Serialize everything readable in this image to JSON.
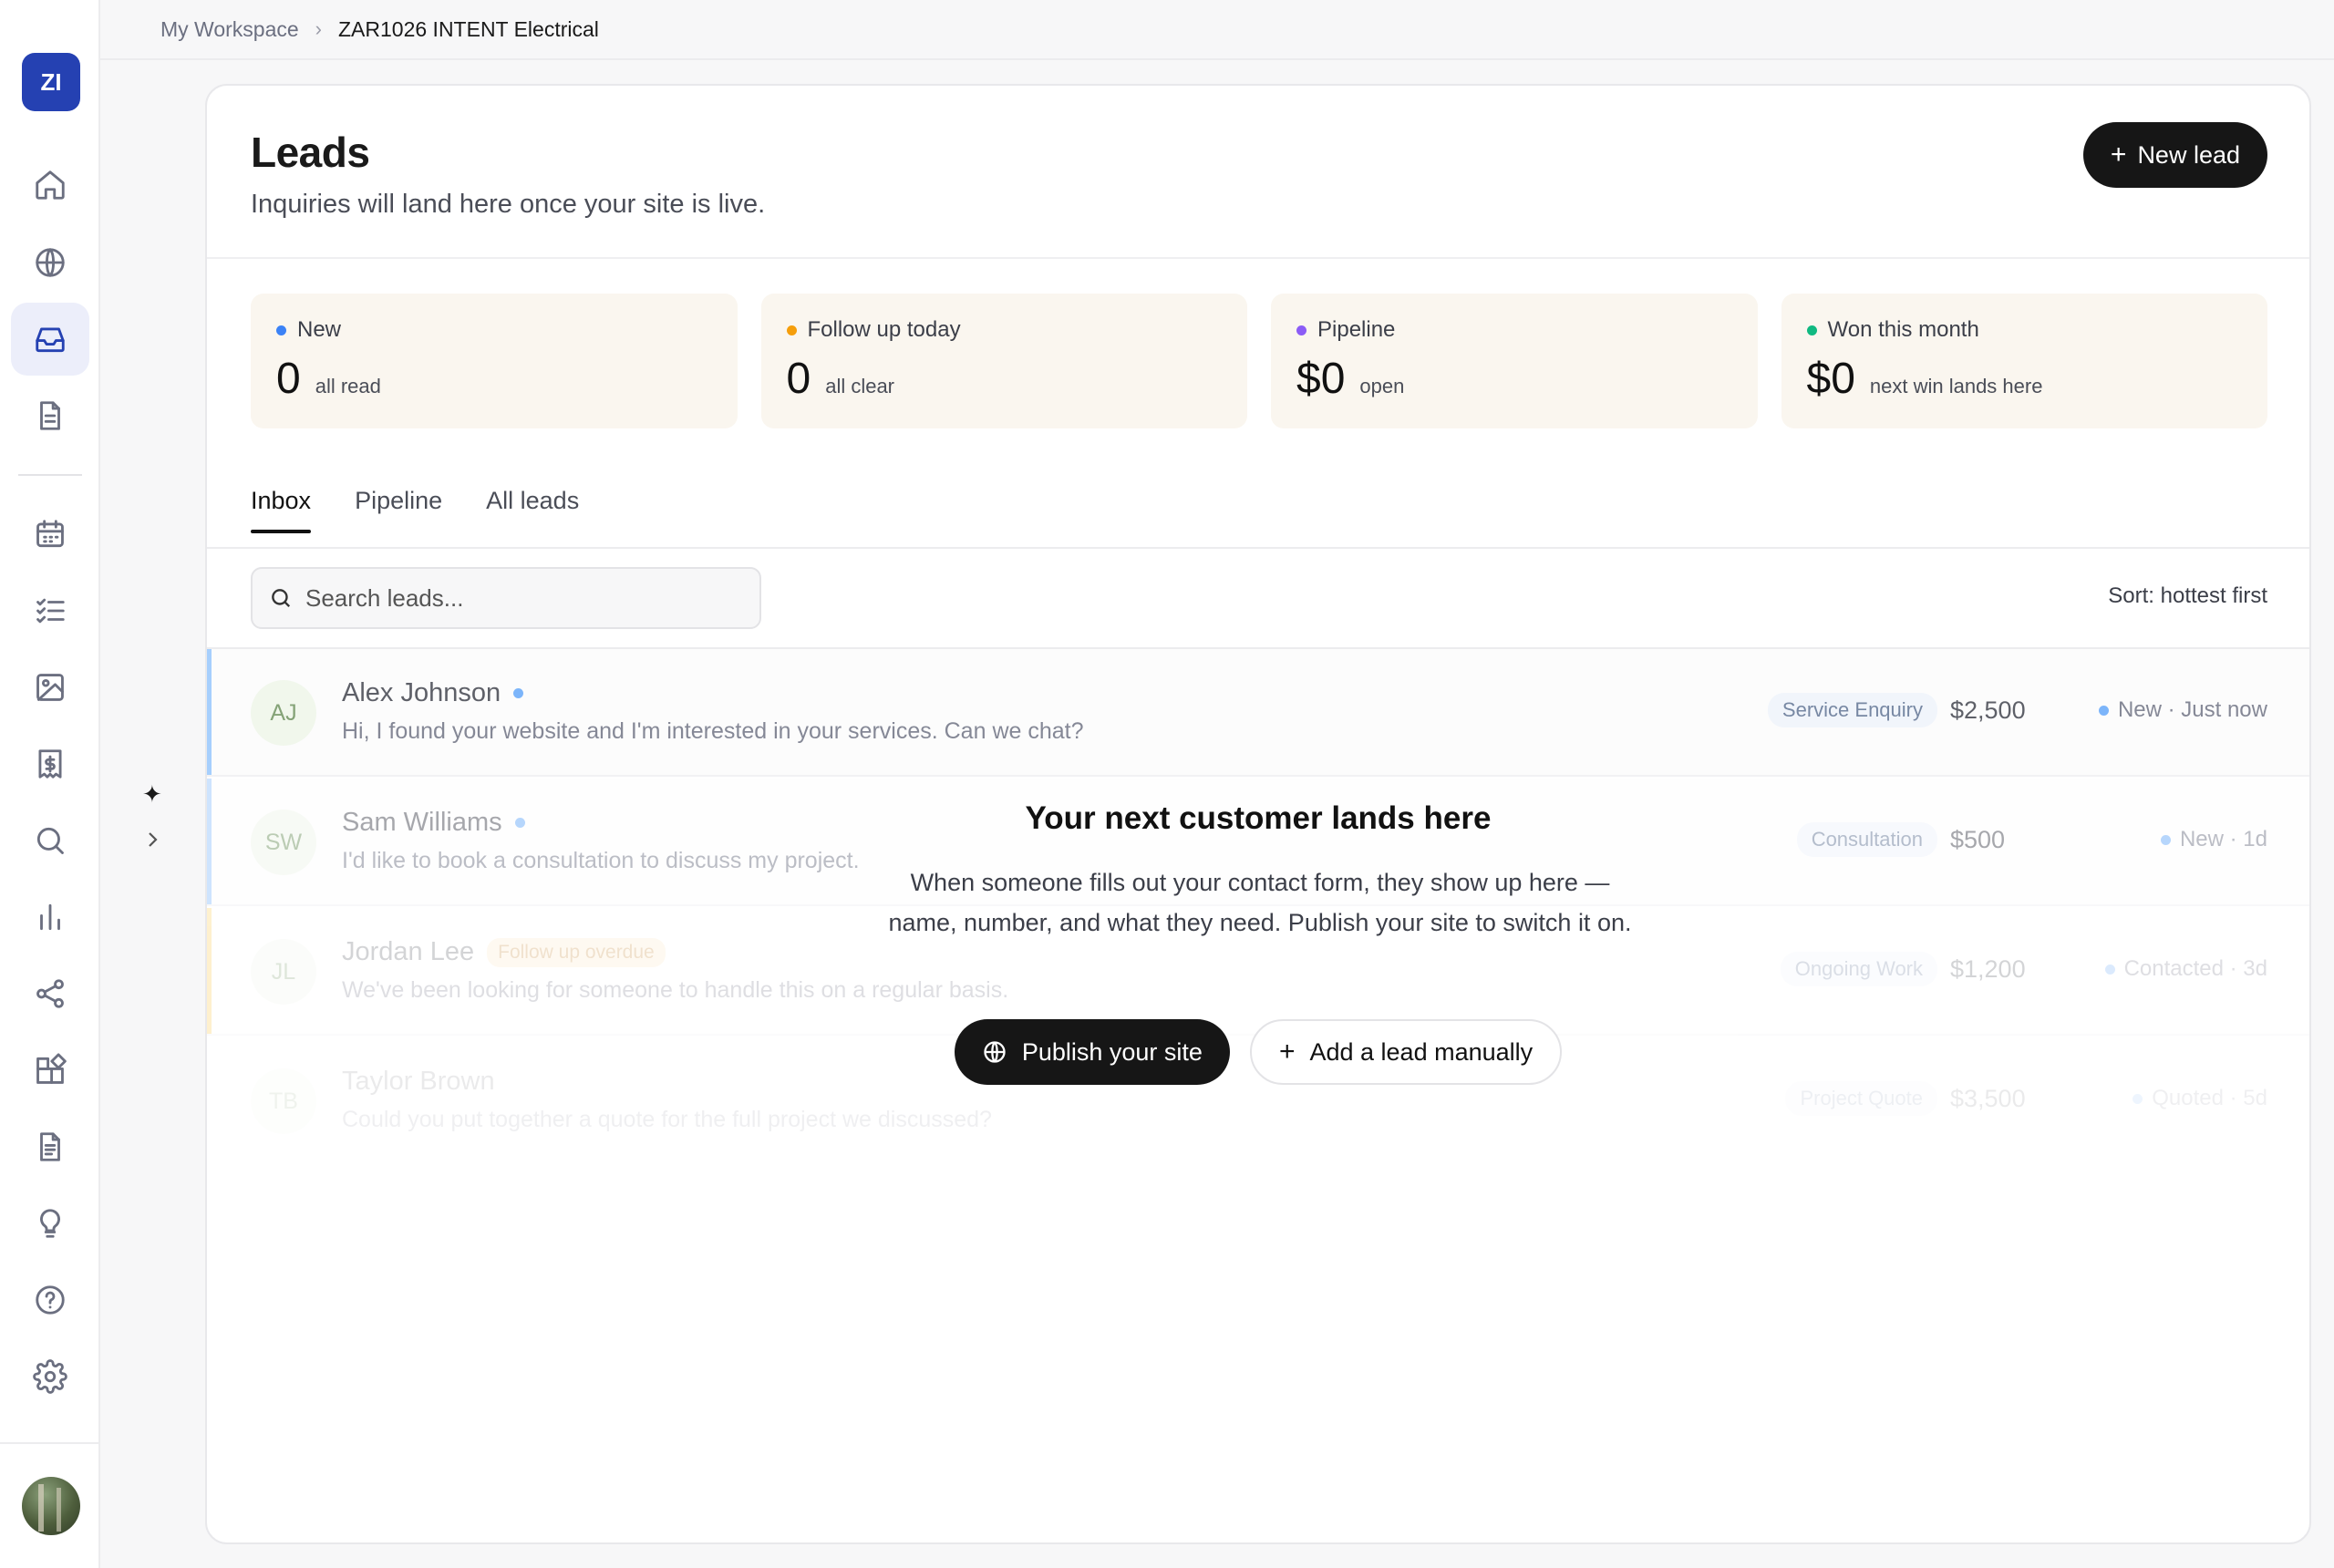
{
  "workspace": {
    "initials": "ZI"
  },
  "breadcrumb": {
    "root": "My Workspace",
    "current": "ZAR1026 INTENT Electrical"
  },
  "sidebar": {
    "icons": [
      "home-icon",
      "globe-icon",
      "inbox-icon",
      "document-icon",
      "calendar-icon",
      "checklist-icon",
      "image-icon",
      "invoice-icon",
      "search-icon",
      "bar-chart-icon",
      "share-icon",
      "widgets-icon",
      "file-text-icon",
      "lightbulb-icon",
      "help-icon",
      "gear-icon"
    ],
    "active": "inbox-icon"
  },
  "page": {
    "title": "Leads",
    "subtitle": "Inquiries will land here once your site is live.",
    "new_lead_label": "New lead"
  },
  "stats": [
    {
      "label": "New",
      "value": "0",
      "note": "all read",
      "color": "#3b82f6"
    },
    {
      "label": "Follow up today",
      "value": "0",
      "note": "all clear",
      "color": "#f59e0b"
    },
    {
      "label": "Pipeline",
      "value": "$0",
      "note": "open",
      "color": "#8b5cf6"
    },
    {
      "label": "Won this month",
      "value": "$0",
      "note": "next win lands here",
      "color": "#10b981"
    }
  ],
  "tabs": [
    "Inbox",
    "Pipeline",
    "All leads"
  ],
  "search": {
    "placeholder": "Search leads..."
  },
  "sort_label": "Sort: hottest first",
  "leads": [
    {
      "initials": "AJ",
      "name": "Alex Johnson",
      "message": "Hi, I found your website and I'm interested in your services. Can we chat?",
      "tag": "Service Enquiry",
      "amount": "$2,500",
      "status": "New · Just now",
      "badge": ""
    },
    {
      "initials": "SW",
      "name": "Sam Williams",
      "message": "I'd like to book a consultation to discuss my project.",
      "tag": "Consultation",
      "amount": "$500",
      "status": "New · 1d",
      "badge": ""
    },
    {
      "initials": "JL",
      "name": "Jordan Lee",
      "message": "We've been looking for someone to handle this on a regular basis.",
      "tag": "Ongoing Work",
      "amount": "$1,200",
      "status": "Contacted · 3d",
      "badge": "Follow up overdue"
    },
    {
      "initials": "TB",
      "name": "Taylor Brown",
      "message": "Could you put together a quote for the full project we discussed?",
      "tag": "Project Quote",
      "amount": "$3,500",
      "status": "Quoted · 5d",
      "badge": ""
    }
  ],
  "empty_state": {
    "title": "Your next customer lands here",
    "description": "When someone fills out your contact form, they show up here — name, number, and what they need. Publish your site to switch it on.",
    "publish_label": "Publish your site",
    "add_label": "Add a lead manually"
  },
  "colors": {
    "accent": "#2541b2",
    "dark_button": "#161616",
    "stat_bg": "#faf6ef"
  }
}
